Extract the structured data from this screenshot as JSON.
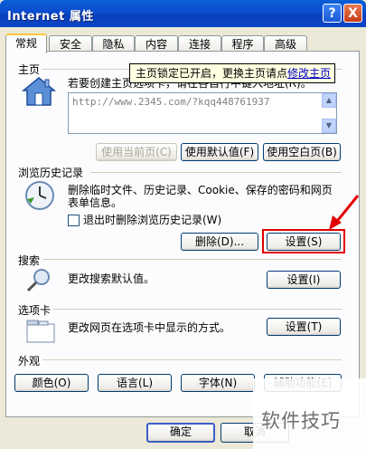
{
  "window": {
    "title": "Internet 属性",
    "help": "?",
    "close": "X"
  },
  "tabs": [
    "常规",
    "安全",
    "隐私",
    "内容",
    "连接",
    "程序",
    "高级"
  ],
  "home": {
    "label": "主页",
    "prompt": "若要创建主页选项卡，请在各自行中键入地址(R)。",
    "url": "http://www.2345.com/?kqq448761937",
    "btn_current": "使用当前页(C)",
    "btn_default": "使用默认值(F)",
    "btn_blank": "使用空白页(B)",
    "tooltip_text": "主页锁定已开启，更换主页请点",
    "tooltip_link": "修改主页"
  },
  "history": {
    "label": "浏览历史记录",
    "desc_line1": "删除临时文件、历史记录、Cookie、保存的密码和网页",
    "desc_line2": "表单信息。",
    "checkbox_label": "退出时删除浏览历史记录(W)",
    "btn_delete": "删除(D)...",
    "btn_settings": "设置(S)"
  },
  "search": {
    "label": "搜索",
    "desc": "更改搜索默认值。",
    "btn_settings": "设置(I)"
  },
  "tabsgroup": {
    "label": "选项卡",
    "desc": "更改网页在选项卡中显示的方式。",
    "btn_settings": "设置(T)"
  },
  "appearance": {
    "label": "外观",
    "btn_colors": "颜色(O)",
    "btn_languages": "语言(L)",
    "btn_fonts": "字体(N)",
    "btn_accessibility": "辅助功能(E)"
  },
  "footer": {
    "ok": "确定",
    "cancel": "取消"
  },
  "watermark": "软件技巧",
  "colors": {
    "highlight": "#e00000",
    "title_blue": "#0b4ccf"
  }
}
